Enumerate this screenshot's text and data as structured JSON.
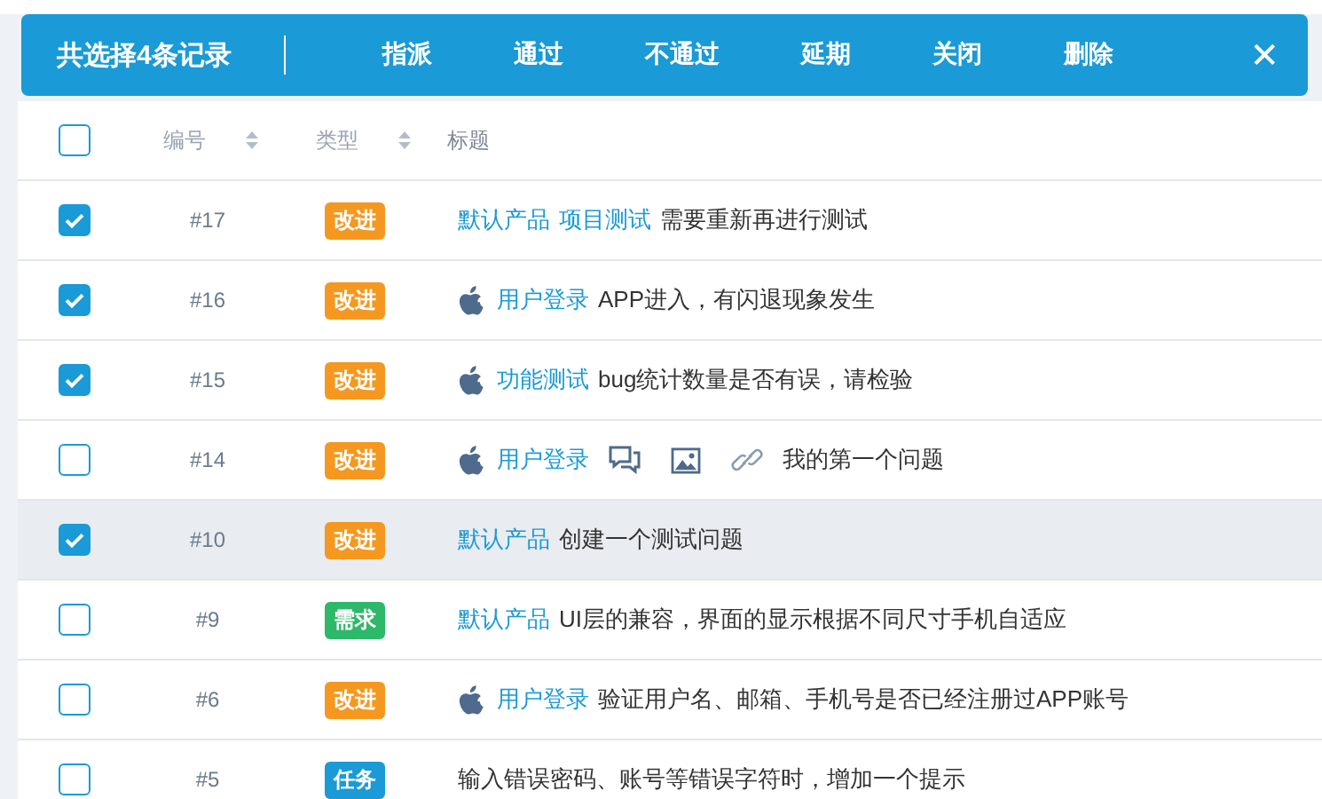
{
  "toolbar": {
    "title": "共选择4条记录",
    "actions": [
      "指派",
      "通过",
      "不通过",
      "延期",
      "关闭",
      "删除"
    ],
    "close": "✕"
  },
  "table": {
    "header": {
      "checked": false,
      "columns": [
        {
          "label": "编号",
          "sortable": true
        },
        {
          "label": "类型",
          "sortable": true
        },
        {
          "label": "标题",
          "sortable": false
        }
      ]
    },
    "rows": [
      {
        "checked": true,
        "highlighted": false,
        "id": "#17",
        "tag": {
          "label": "改进",
          "color": "#f5981f"
        },
        "apple": false,
        "links": [
          "默认产品",
          "项目测试"
        ],
        "attachments": [],
        "text": "需要重新再进行测试"
      },
      {
        "checked": true,
        "highlighted": false,
        "id": "#16",
        "tag": {
          "label": "改进",
          "color": "#f5981f"
        },
        "apple": true,
        "links": [
          "用户登录"
        ],
        "attachments": [],
        "text": "APP进入，有闪退现象发生"
      },
      {
        "checked": true,
        "highlighted": false,
        "id": "#15",
        "tag": {
          "label": "改进",
          "color": "#f5981f"
        },
        "apple": true,
        "links": [
          "功能测试"
        ],
        "attachments": [],
        "text": "bug统计数量是否有误，请检验"
      },
      {
        "checked": false,
        "highlighted": false,
        "id": "#14",
        "tag": {
          "label": "改进",
          "color": "#f5981f"
        },
        "apple": true,
        "links": [
          "用户登录"
        ],
        "attachments": [
          {
            "kind": "comment"
          },
          {
            "kind": "image"
          },
          {
            "kind": "link"
          }
        ],
        "text": "我的第一个问题"
      },
      {
        "checked": true,
        "highlighted": true,
        "id": "#10",
        "tag": {
          "label": "改进",
          "color": "#f5981f"
        },
        "apple": false,
        "links": [
          "默认产品"
        ],
        "attachments": [],
        "text": "创建一个测试问题"
      },
      {
        "checked": false,
        "highlighted": false,
        "id": "#9",
        "tag": {
          "label": "需求",
          "color": "#2db86a"
        },
        "apple": false,
        "links": [
          "默认产品"
        ],
        "attachments": [],
        "text": "UI层的兼容，界面的显示根据不同尺寸手机自适应"
      },
      {
        "checked": false,
        "highlighted": false,
        "id": "#6",
        "tag": {
          "label": "改进",
          "color": "#f5981f"
        },
        "apple": true,
        "links": [
          "用户登录"
        ],
        "attachments": [],
        "text": "验证用户名、邮箱、手机号是否已经注册过APP账号"
      },
      {
        "checked": false,
        "highlighted": false,
        "id": "#5",
        "tag": {
          "label": "任务",
          "color": "#1a9ad6"
        },
        "apple": false,
        "links": [],
        "attachments": [],
        "text": "输入错误密码、账号等错误字符时，增加一个提示"
      }
    ]
  }
}
